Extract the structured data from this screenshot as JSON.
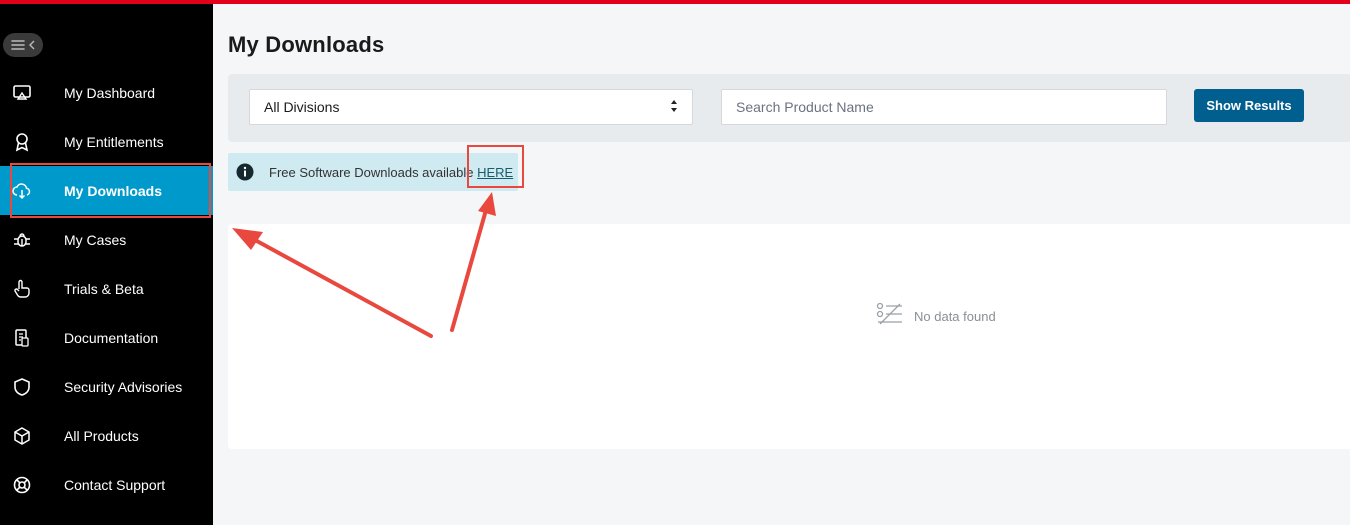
{
  "sidebar": {
    "items": [
      {
        "id": "dashboard",
        "label": "My Dashboard",
        "icon": "monitor-icon",
        "active": false
      },
      {
        "id": "entitlements",
        "label": "My Entitlements",
        "icon": "award-icon",
        "active": false
      },
      {
        "id": "downloads",
        "label": "My Downloads",
        "icon": "cloud-download-icon",
        "active": true
      },
      {
        "id": "cases",
        "label": "My Cases",
        "icon": "bug-icon",
        "active": false
      },
      {
        "id": "trials",
        "label": "Trials & Beta",
        "icon": "pointer-hand-icon",
        "active": false
      },
      {
        "id": "documentation",
        "label": "Documentation",
        "icon": "document-icon",
        "active": false
      },
      {
        "id": "security",
        "label": "Security Advisories",
        "icon": "shield-icon",
        "active": false
      },
      {
        "id": "products",
        "label": "All Products",
        "icon": "cube-icon",
        "active": false
      },
      {
        "id": "support",
        "label": "Contact Support",
        "icon": "lifebuoy-icon",
        "active": false
      }
    ]
  },
  "main": {
    "title": "My Downloads",
    "filter": {
      "division_selected": "All Divisions",
      "search_placeholder": "Search Product Name",
      "search_value": "",
      "show_results_label": "Show Results"
    },
    "alert": {
      "text": "Free Software Downloads available ",
      "link_text": "HERE"
    },
    "results": {
      "empty_text": "No data found"
    }
  },
  "colors": {
    "top_accent": "#e2001a",
    "sidebar_bg": "#000000",
    "active_item": "#0099cc",
    "primary_button": "#005f8f",
    "alert_bg": "#cfeaf0",
    "annotation": "#e8483e"
  }
}
